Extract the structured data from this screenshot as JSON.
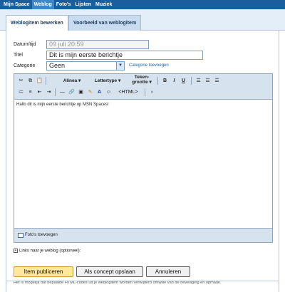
{
  "nav": {
    "items": [
      "Mijn Space",
      "Weblog",
      "Foto's",
      "Lijsten",
      "Muziek"
    ],
    "active": "Weblog"
  },
  "tabs": {
    "edit": "Weblogitem bewerken",
    "preview": "Voorbeeld van weblogitem"
  },
  "form": {
    "date_label": "Datum/tijd",
    "date_value": "09 juli 20:59",
    "title_label": "Titel",
    "title_value": "Dit is mijn eerste berichtje",
    "category_label": "Categorie",
    "category_value": "Geen",
    "add_category": "Categorie toevoegen"
  },
  "toolbar": {
    "paragraph": "Alinea",
    "font": "Lettertype",
    "size_line1": "Teken-",
    "size_line2": "grootte",
    "bold": "B",
    "italic": "I",
    "underline": "U",
    "html": "<HTML>"
  },
  "editor": {
    "body": "Hallo dit is mijn eerste berichtje op MSN Spaces!"
  },
  "photos": {
    "label": "Foto's toevoegen"
  },
  "links": {
    "label": "Links naar je weblog (optioneel):"
  },
  "buttons": {
    "publish": "Item publiceren",
    "draft": "Als concept opslaan",
    "cancel": "Annuleren"
  },
  "note": "Het is mogelijk dat bepaalde HTML-codes uit je weblogitem worden verwijderd omwille van de beveiliging en opmaak.",
  "colors": {
    "nav": "#1a5e9e",
    "tabs": "#e4eef8",
    "toolbar": "#d6e2ee",
    "primary_button": "#ffe79c"
  }
}
